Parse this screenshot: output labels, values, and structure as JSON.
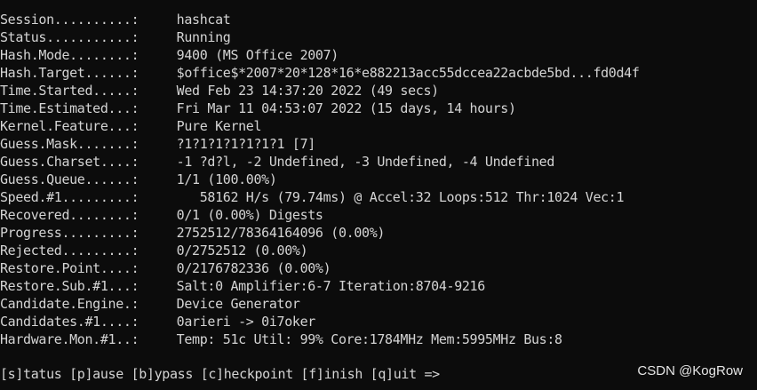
{
  "terminal": {
    "lines": [
      {
        "label": "Session..........:",
        "value": " hashcat"
      },
      {
        "label": "Status...........:",
        "value": " Running"
      },
      {
        "label": "Hash.Mode........:",
        "value": " 9400 (MS Office 2007)"
      },
      {
        "label": "Hash.Target......:",
        "value": " $office$*2007*20*128*16*e882213acc55dccea22acbde5bd...fd0d4f"
      },
      {
        "label": "Time.Started.....:",
        "value": " Wed Feb 23 14:37:20 2022 (49 secs)"
      },
      {
        "label": "Time.Estimated...:",
        "value": " Fri Mar 11 04:53:07 2022 (15 days, 14 hours)"
      },
      {
        "label": "Kernel.Feature...:",
        "value": " Pure Kernel"
      },
      {
        "label": "Guess.Mask.......:",
        "value": " ?1?1?1?1?1?1?1 [7]"
      },
      {
        "label": "Guess.Charset....:",
        "value": " -1 ?d?l, -2 Undefined, -3 Undefined, -4 Undefined"
      },
      {
        "label": "Guess.Queue......:",
        "value": " 1/1 (100.00%)"
      },
      {
        "label": "Speed.#1.........:",
        "value": "    58162 H/s (79.74ms) @ Accel:32 Loops:512 Thr:1024 Vec:1"
      },
      {
        "label": "Recovered........:",
        "value": " 0/1 (0.00%) Digests"
      },
      {
        "label": "Progress.........:",
        "value": " 2752512/78364164096 (0.00%)"
      },
      {
        "label": "Rejected.........:",
        "value": " 0/2752512 (0.00%)"
      },
      {
        "label": "Restore.Point....:",
        "value": " 0/2176782336 (0.00%)"
      },
      {
        "label": "Restore.Sub.#1...:",
        "value": " Salt:0 Amplifier:6-7 Iteration:8704-9216"
      },
      {
        "label": "Candidate.Engine.:",
        "value": " Device Generator"
      },
      {
        "label": "Candidates.#1....:",
        "value": " 0arieri -> 0i7oker"
      },
      {
        "label": "Hardware.Mon.#1..:",
        "value": " Temp: 51c Util: 99% Core:1784MHz Mem:5995MHz Bus:8"
      }
    ],
    "prompt": "[s]tatus [p]ause [b]ypass [c]heckpoint [f]inish [q]uit =>"
  },
  "watermark": "CSDN @KogRow",
  "colors": {
    "background": "#0c0c0c",
    "text": "#d4d4d4"
  }
}
